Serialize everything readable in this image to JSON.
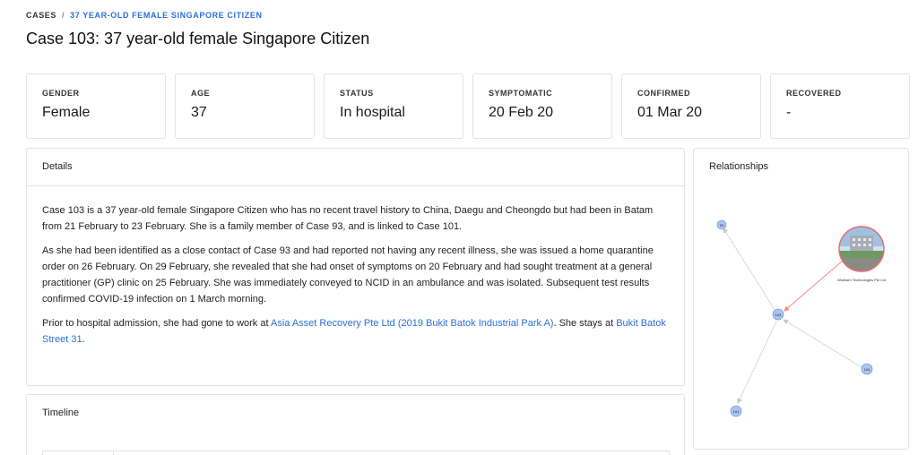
{
  "breadcrumb": {
    "root": "CASES",
    "separator": "/",
    "current": "37 YEAR-OLD FEMALE SINGAPORE CITIZEN"
  },
  "title": "Case 103: 37 year-old female Singapore Citizen",
  "stats": [
    {
      "label": "GENDER",
      "value": "Female"
    },
    {
      "label": "AGE",
      "value": "37"
    },
    {
      "label": "STATUS",
      "value": "In hospital"
    },
    {
      "label": "SYMPTOMATIC",
      "value": "20 Feb 20"
    },
    {
      "label": "CONFIRMED",
      "value": "01 Mar 20"
    },
    {
      "label": "RECOVERED",
      "value": "-"
    }
  ],
  "details": {
    "heading": "Details",
    "p1": "Case 103 is a 37 year-old female Singapore Citizen who has no recent travel history to China, Daegu and Cheongdo but had been in Batam from 21 February to 23 February. She is a family member of Case 93, and is linked to Case 101.",
    "p2": "As she had been identified as a close contact of Case 93 and had reported not having any recent illness, she was issued a home quarantine order on 26 February. On 29 February, she revealed that she had onset of symptoms on 20 February and had sought treatment at a general practitioner (GP) clinic on 25 February. She was immediately conveyed to NCID in an ambulance and was isolated. Subsequent test results confirmed COVID-19 infection on 1 March morning.",
    "p3_before": "Prior to hospital admission, she had gone to work at ",
    "p3_link1": "Asia Asset Recovery Pte Ltd (2019 Bukit Batok Industrial Park A)",
    "p3_middle": ". She stays at ",
    "p3_link2": "Bukit Batok Street 31",
    "p3_after": "."
  },
  "timeline": {
    "heading": "Timeline"
  },
  "relationships": {
    "heading": "Relationships",
    "nodes": {
      "n93": "93",
      "n103": "103",
      "n104": "104",
      "n101": "101"
    },
    "place_label": "Wizlearn Technologies Pte Ltd",
    "colors": {
      "node": "#a9c6ef",
      "node_stroke": "#5d8fd3",
      "edge_grey": "#c8c8c8",
      "edge_red": "#f08a8a"
    }
  }
}
